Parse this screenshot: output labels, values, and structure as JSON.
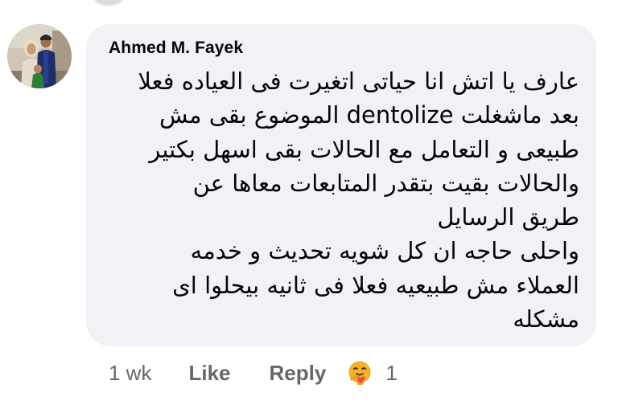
{
  "comment": {
    "author": "Ahmed M. Fayek",
    "avatar_icon": "profile-photo",
    "text_lines": [
      "عارف يا اتش انا حياتى اتغيرت فى العياده فعلا",
      "بعد ماشغلت dentolize الموضوع بقى مش",
      "طبيعى و التعامل مع الحالات بقى اسهل بكتير",
      "والحالات بقيت بتقدر المتابعات معاها عن",
      "طريق الرسايل",
      "واحلى حاجه ان كل شويه تحديث و خدمه",
      "العملاء مش طبيعيه فعلا فى ثانيه بيحلوا اى",
      "مشكله"
    ],
    "bubble_color": "#f0f2f5"
  },
  "actions": {
    "timestamp": "1 wk",
    "like_label": "Like",
    "reply_label": "Reply",
    "reaction_icon": "care-reaction-icon",
    "reaction_count": "1",
    "text_color": "#65676b"
  }
}
